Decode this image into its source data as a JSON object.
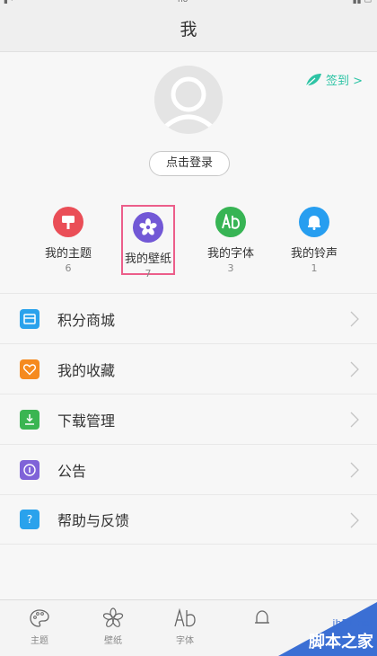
{
  "status_bar": {
    "left": "▮ ·",
    "center": "ho",
    "right": "▮▮ ▭"
  },
  "header": {
    "title": "我"
  },
  "profile": {
    "signin_label": "签到 >",
    "login_button": "点击登录"
  },
  "quick_links": [
    {
      "label": "我的主题",
      "count": "6",
      "icon": "brush-icon",
      "color": "#ea4e57"
    },
    {
      "label": "我的壁纸",
      "count": "7",
      "icon": "flower-icon",
      "color": "#7258d6"
    },
    {
      "label": "我的字体",
      "count": "3",
      "icon": "font-icon",
      "color": "#37b454"
    },
    {
      "label": "我的铃声",
      "count": "1",
      "icon": "bell-icon",
      "color": "#279ef0"
    }
  ],
  "menu": [
    {
      "label": "积分商城",
      "icon": "store-icon",
      "color": "#2aa2ec"
    },
    {
      "label": "我的收藏",
      "icon": "heart-icon",
      "color": "#f58a1f"
    },
    {
      "label": "下载管理",
      "icon": "download-icon",
      "color": "#3bb552"
    },
    {
      "label": "公告",
      "icon": "info-icon",
      "color": "#7f63d8"
    },
    {
      "label": "帮助与反馈",
      "icon": "help-icon",
      "color": "#2aa2ec"
    }
  ],
  "tabs": [
    {
      "label": "主题",
      "icon": "palette-icon"
    },
    {
      "label": "壁纸",
      "icon": "flower-outline-icon"
    },
    {
      "label": "字体",
      "icon": "font-outline-icon"
    },
    {
      "label": "",
      "icon": "bell-outline-icon"
    }
  ],
  "watermark": {
    "url": "jb51.net",
    "text": "脚本之家"
  },
  "colors": {
    "accent_green": "#2ec4a5",
    "highlight_border": "#ec5e8a",
    "watermark_blue": "#3b6fd4"
  }
}
